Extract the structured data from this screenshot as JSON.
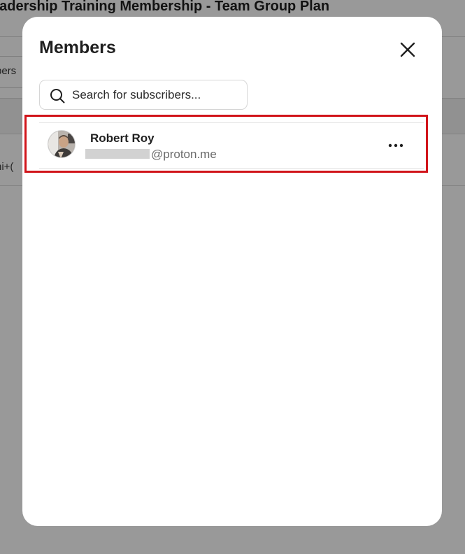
{
  "background": {
    "page_title": "eadership Training Membership - Team Group Plan",
    "tab_fragment": "bers",
    "row_fragment": "ni+("
  },
  "modal": {
    "title": "Members",
    "close_icon": "close-icon",
    "search": {
      "placeholder": "Search for subscribers...",
      "value": "",
      "icon": "search-icon"
    },
    "members": [
      {
        "name": "Robert Roy",
        "email_visible": "@proton.me",
        "email_redacted": true,
        "avatar": "avatar",
        "actions_icon": "more-horizontal-icon"
      }
    ],
    "highlight_color": "#d1141a"
  }
}
